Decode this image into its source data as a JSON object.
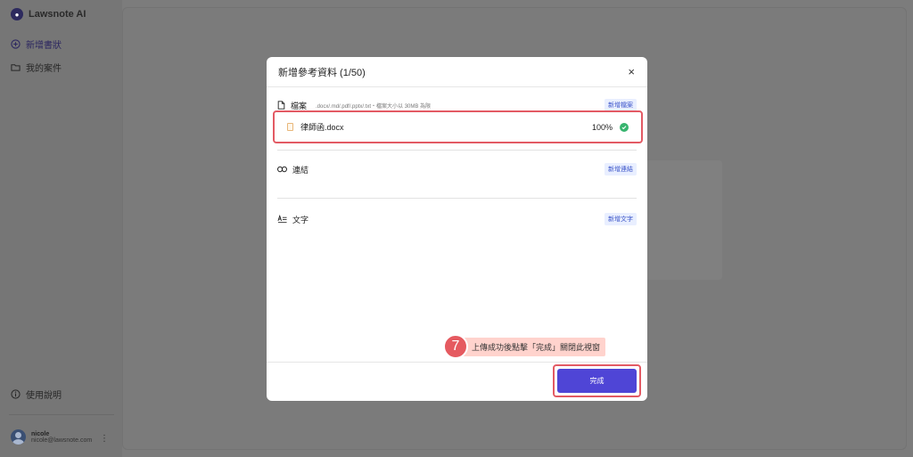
{
  "app": {
    "brand": "Lawsnote AI",
    "nav": {
      "new_brief": "新增書狀",
      "my_cases": "我的案件"
    },
    "help": "使用說明",
    "user": {
      "name": "nicole",
      "email": "nicole@lawsnote.com",
      "menu_glyph": "⋮"
    }
  },
  "modal": {
    "title": "新增參考資料 (1/50)",
    "close_glyph": "×",
    "sections": {
      "file": {
        "label": "檔案",
        "hint": ".docx/.md/.pdf/.pptx/.txt・檔案大小以 30MB 為限",
        "add_label": "新增檔案"
      },
      "link": {
        "label": "連結",
        "add_label": "新增連結"
      },
      "text": {
        "label": "文字",
        "add_label": "新增文字"
      }
    },
    "uploaded_file": {
      "name": "律師函.docx",
      "progress": "100%"
    },
    "done_label": "完成"
  },
  "annotation": {
    "step": "7",
    "text": "上傳成功後點擊「完成」關閉此視窗"
  },
  "colors": {
    "accent": "#4f45d6",
    "highlight": "#e35a64",
    "success": "#38b46f"
  }
}
